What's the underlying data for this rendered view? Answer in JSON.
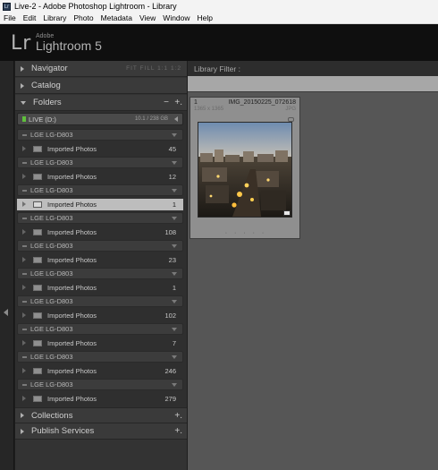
{
  "window": {
    "app_icon_glyph": "Lr",
    "title": "Live-2 - Adobe Photoshop Lightroom - Library"
  },
  "menu": [
    "File",
    "Edit",
    "Library",
    "Photo",
    "Metadata",
    "View",
    "Window",
    "Help"
  ],
  "identity": {
    "logo": "Lr",
    "adobe": "Adobe",
    "product": "Lightroom 5"
  },
  "panels": {
    "navigator": {
      "label": "Navigator",
      "options": "FIT  FILL  1:1  1:2"
    },
    "catalog": {
      "label": "Catalog"
    },
    "folders": {
      "label": "Folders",
      "minus": "−",
      "plus": "+."
    },
    "collections": {
      "label": "Collections",
      "plus": "+."
    },
    "publish": {
      "label": "Publish Services",
      "plus": "+."
    }
  },
  "volume": {
    "name": "LIVE (D:)",
    "size": "10.1 / 238 GB"
  },
  "folder_rows": [
    {
      "device": "LGE LG-D803",
      "folder": "Imported Photos",
      "count": "45",
      "selected": false
    },
    {
      "device": "LGE LG-D803",
      "folder": "Imported Photos",
      "count": "12",
      "selected": false
    },
    {
      "device": "LGE LG-D803",
      "folder": "Imported Photos",
      "count": "1",
      "selected": true
    },
    {
      "device": "LGE LG-D803",
      "folder": "Imported Photos",
      "count": "108",
      "selected": false
    },
    {
      "device": "LGE LG-D803",
      "folder": "Imported Photos",
      "count": "23",
      "selected": false
    },
    {
      "device": "LGE LG-D803",
      "folder": "Imported Photos",
      "count": "1",
      "selected": false
    },
    {
      "device": "LGE LG-D803",
      "folder": "Imported Photos",
      "count": "102",
      "selected": false
    },
    {
      "device": "LGE LG-D803",
      "folder": "Imported Photos",
      "count": "7",
      "selected": false
    },
    {
      "device": "LGE LG-D803",
      "folder": "Imported Photos",
      "count": "246",
      "selected": false
    },
    {
      "device": "LGE LG-D803",
      "folder": "Imported Photos",
      "count": "279",
      "selected": false
    }
  ],
  "library_filter": {
    "label": "Library Filter :"
  },
  "grid_cell": {
    "index": "1",
    "filename": "IMG_20150225_072618",
    "dimensions": "1365 x 1365",
    "extension": "JPG",
    "dots": "· · · · ·"
  }
}
